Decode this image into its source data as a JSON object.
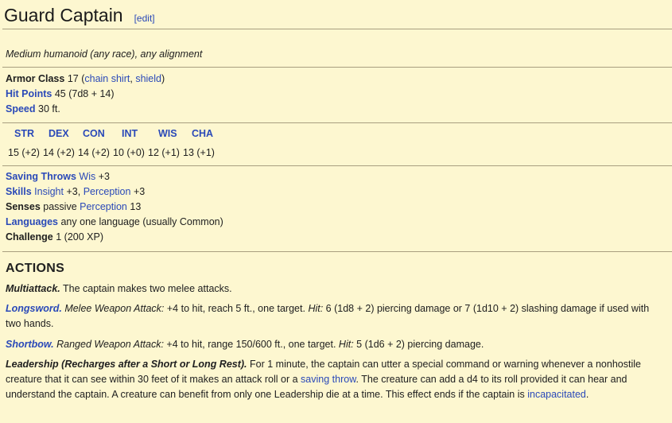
{
  "header": {
    "title": "Guard Captain",
    "edit_label": "[edit]"
  },
  "subtitle": "Medium humanoid (any race), any alignment",
  "basics": {
    "ac_label": "Armor Class",
    "ac_value": "17 (",
    "ac_link1": "chain shirt",
    "ac_sep": ", ",
    "ac_link2": "shield",
    "ac_close": ")",
    "hp_label": "Hit Points",
    "hp_value": "45 (7d8 + 14)",
    "speed_label": "Speed",
    "speed_value": "30 ft."
  },
  "abilities": {
    "headers": [
      "STR",
      "DEX",
      "CON",
      "INT",
      "WIS",
      "CHA"
    ],
    "values": [
      "15 (+2)",
      "14 (+2)",
      "14 (+2)",
      "10 (+0)",
      "12 (+1)",
      "13 (+1)"
    ]
  },
  "traits": {
    "saves_label": "Saving Throws",
    "saves_link": "Wis",
    "saves_value": "+3",
    "skills_label": "Skills",
    "skills_link1": "Insight",
    "skills_v1": "+3, ",
    "skills_link2": "Perception",
    "skills_v2": "+3",
    "senses_label": "Senses",
    "senses_pre": "passive ",
    "senses_link": "Perception",
    "senses_val": "13",
    "lang_label": "Languages",
    "lang_value": "any one language (usually Common)",
    "chal_label": "Challenge",
    "chal_value": "1 (200 XP)"
  },
  "actions": {
    "heading": "ACTIONS",
    "multi_name": "Multiattack.",
    "multi_text": "The captain makes two melee attacks.",
    "long_name": "Longsword.",
    "long_type": "Melee Weapon Attack:",
    "long_text1": "+4 to hit, reach 5 ft., one target.",
    "long_hit": "Hit:",
    "long_text2": "6 (1d8 + 2) piercing damage or 7 (1d10 + 2) slashing damage if used with two hands.",
    "short_name": "Shortbow.",
    "short_type": "Ranged Weapon Attack:",
    "short_text1": "+4 to hit, range 150/600 ft., one target.",
    "short_hit": "Hit:",
    "short_text2": "5 (1d6 + 2) piercing damage.",
    "lead_name": "Leadership (Recharges after a Short or Long Rest).",
    "lead_text1": "For 1 minute, the captain can utter a special command or warning whenever a nonhostile creature that it can see within 30 feet of it makes an attack roll or a",
    "lead_link1": "saving throw",
    "lead_text2": ". The creature can add a d4 to its roll provided it can hear and understand the captain. A creature can benefit from only one Leadership die at a time. This effect ends if the captain is",
    "lead_link2": "incapacitated",
    "lead_text3": "."
  }
}
